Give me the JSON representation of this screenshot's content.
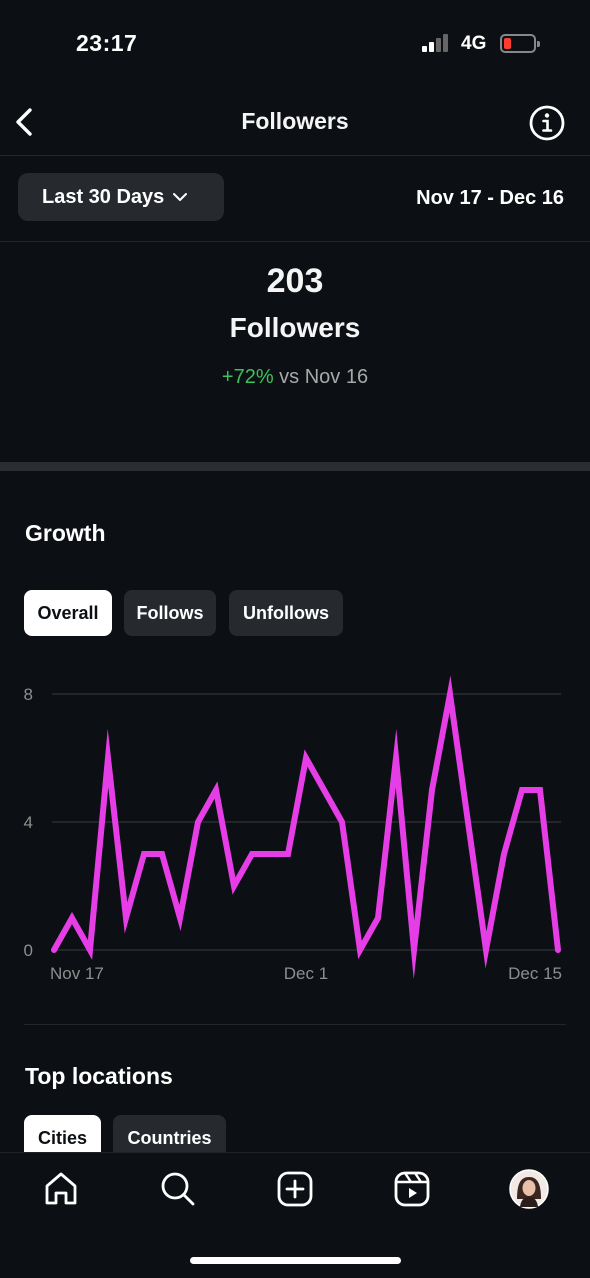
{
  "status_bar": {
    "time": "23:17",
    "network": "4G",
    "battery_level": 0.2,
    "battery_color": "#ff3b30"
  },
  "header": {
    "title": "Followers",
    "back_icon": "chevron-left-icon",
    "info_icon": "info-icon"
  },
  "range": {
    "selector_label": "Last 30 Days",
    "dates": "Nov 17 - Dec 16"
  },
  "summary": {
    "count": "203",
    "label": "Followers",
    "change": "+72%",
    "change_suffix": "vs Nov 16",
    "positive_color": "#3dc15a"
  },
  "growth": {
    "title": "Growth",
    "tabs": [
      {
        "label": "Overall",
        "active": true
      },
      {
        "label": "Follows",
        "active": false
      },
      {
        "label": "Unfollows",
        "active": false
      }
    ]
  },
  "chart_data": {
    "type": "line",
    "x": [
      "Nov 17",
      "Nov 18",
      "Nov 19",
      "Nov 20",
      "Nov 21",
      "Nov 22",
      "Nov 23",
      "Nov 24",
      "Nov 25",
      "Nov 26",
      "Nov 27",
      "Nov 28",
      "Nov 29",
      "Nov 30",
      "Dec 1",
      "Dec 2",
      "Dec 3",
      "Dec 4",
      "Dec 5",
      "Dec 6",
      "Dec 7",
      "Dec 8",
      "Dec 9",
      "Dec 10",
      "Dec 11",
      "Dec 12",
      "Dec 13",
      "Dec 14",
      "Dec 15",
      "Dec 16"
    ],
    "series": [
      {
        "values": [
          0,
          1,
          0,
          6,
          1,
          3,
          3,
          1,
          4,
          5,
          2,
          3,
          3,
          3,
          6,
          5,
          4,
          0,
          1,
          6,
          0,
          5,
          8,
          4,
          0,
          3,
          5,
          5,
          0
        ]
      }
    ],
    "x_tick_labels": [
      "Nov 17",
      "Dec 1",
      "Dec 15"
    ],
    "y_ticks": [
      0,
      4,
      8
    ],
    "ylim": [
      0,
      8
    ],
    "grid": true,
    "line_color": "#e63ee6"
  },
  "locations": {
    "title": "Top locations",
    "tabs": [
      {
        "label": "Cities",
        "active": true
      },
      {
        "label": "Countries",
        "active": false
      }
    ]
  },
  "nav": {
    "items": [
      "home-icon",
      "search-icon",
      "create-icon",
      "reels-icon",
      "profile-avatar"
    ]
  }
}
